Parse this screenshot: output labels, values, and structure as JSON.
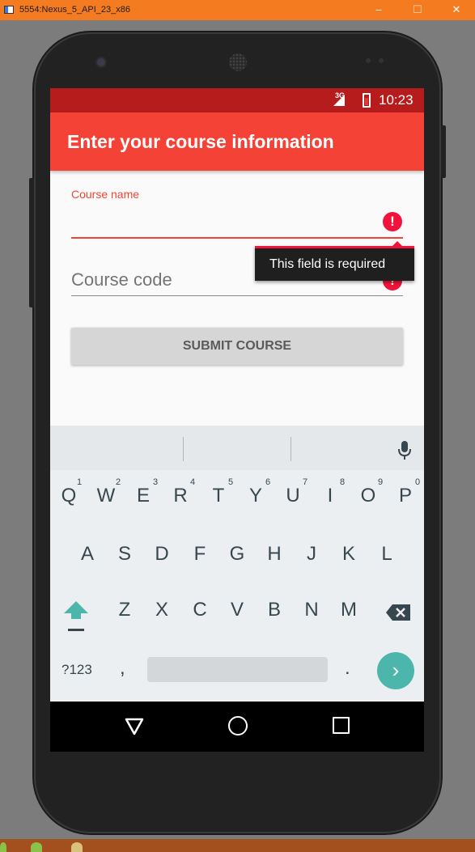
{
  "window": {
    "title": "5554:Nexus_5_API_23_x86",
    "minimize": "–",
    "maximize": "☐",
    "close": "✕"
  },
  "status_bar": {
    "network": "3G",
    "time": "10:23"
  },
  "app_bar": {
    "title": "Enter your course information"
  },
  "form": {
    "course_name_label": "Course name",
    "course_name_value": "",
    "course_code_hint": "Course code",
    "error_message": "This field is required",
    "error_glyph": "!",
    "submit_label": "SUBMIT COURSE"
  },
  "keyboard": {
    "row1": [
      {
        "letter": "Q",
        "num": "1"
      },
      {
        "letter": "W",
        "num": "2"
      },
      {
        "letter": "E",
        "num": "3"
      },
      {
        "letter": "R",
        "num": "4"
      },
      {
        "letter": "T",
        "num": "5"
      },
      {
        "letter": "Y",
        "num": "6"
      },
      {
        "letter": "U",
        "num": "7"
      },
      {
        "letter": "I",
        "num": "8"
      },
      {
        "letter": "O",
        "num": "9"
      },
      {
        "letter": "P",
        "num": "0"
      }
    ],
    "row2": [
      "A",
      "S",
      "D",
      "F",
      "G",
      "H",
      "J",
      "K",
      "L"
    ],
    "row3": [
      "Z",
      "X",
      "C",
      "V",
      "B",
      "N",
      "M"
    ],
    "symbols_key": "?123",
    "comma_key": ",",
    "period_key": ".",
    "enter_glyph": "›"
  },
  "colors": {
    "primary": "#f44336",
    "primary_dark": "#b71c1c",
    "error": "#f0143c",
    "accent": "#4db6ac",
    "window_title_bar": "#f47b20"
  },
  "icons": [
    "error-icon",
    "mic-icon",
    "shift-icon",
    "backspace-icon",
    "enter-icon",
    "back-icon",
    "home-icon",
    "recents-icon"
  ]
}
